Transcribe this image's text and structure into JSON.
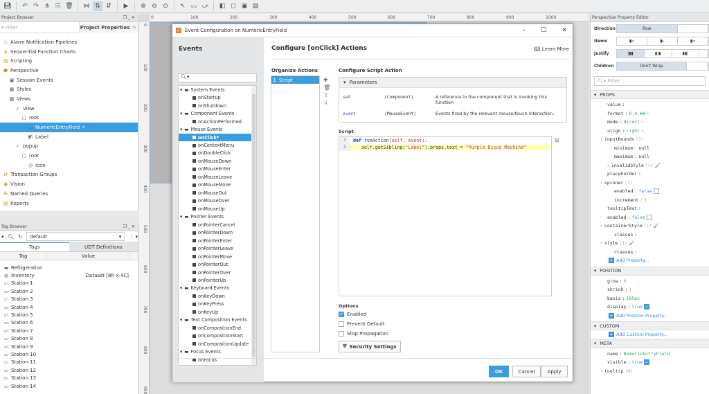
{
  "toolbar": {
    "icons": [
      "save-icon",
      "undo-icon",
      "redo-icon",
      "align-icon",
      "copy-icon",
      "delete-icon",
      "snap-icon",
      "flip-icon",
      "distribute-icon",
      "play-icon",
      "zoom-in-icon",
      "zoom-out-icon",
      "zoom-fit-icon",
      "pointer-icon",
      "bezier-icon",
      "path-icon",
      "group-icon",
      "ungroup-icon",
      "front-icon",
      "back-icon"
    ]
  },
  "project_browser": {
    "title": "Project Browser",
    "filter_placeholder": "Filter",
    "project_properties": "Project Properties",
    "items": [
      {
        "label": "Alarm Notification Pipelines",
        "indent": 0
      },
      {
        "label": "Sequential Function Charts",
        "indent": 0
      },
      {
        "label": "Scripting",
        "indent": 0
      },
      {
        "label": "Perspective",
        "indent": 0
      },
      {
        "label": "Session Events",
        "indent": 1
      },
      {
        "label": "Styles",
        "indent": 1
      },
      {
        "label": "Views",
        "indent": 1
      },
      {
        "label": "View",
        "indent": 2
      },
      {
        "label": "root",
        "indent": 3
      },
      {
        "label": "NumericEntryField",
        "indent": 4,
        "selected": true
      },
      {
        "label": "Label",
        "indent": 4
      },
      {
        "label": "popup",
        "indent": 2
      },
      {
        "label": "root",
        "indent": 3
      },
      {
        "label": "Icon",
        "indent": 4
      },
      {
        "label": "Transaction Groups",
        "indent": 0
      },
      {
        "label": "Vision",
        "indent": 0
      },
      {
        "label": "Named Queries",
        "indent": 0
      },
      {
        "label": "Reports",
        "indent": 0
      }
    ]
  },
  "tag_browser": {
    "title": "Tag Browser",
    "provider": "default",
    "tabs": [
      "Tags",
      "UDT Definitions"
    ],
    "columns": [
      "Tag",
      "Value"
    ],
    "rows": [
      {
        "tag": "Refrigeration",
        "value": ""
      },
      {
        "tag": "Inventory",
        "value": "Dataset [8R x 4C]"
      },
      {
        "tag": "Station 1",
        "value": ""
      },
      {
        "tag": "Station 2",
        "value": ""
      },
      {
        "tag": "Station 3",
        "value": ""
      },
      {
        "tag": "Station 4",
        "value": ""
      },
      {
        "tag": "Station 5",
        "value": ""
      },
      {
        "tag": "Station 6",
        "value": ""
      },
      {
        "tag": "Station 7",
        "value": ""
      },
      {
        "tag": "Station 8",
        "value": ""
      },
      {
        "tag": "Station 9",
        "value": ""
      },
      {
        "tag": "Station 10",
        "value": ""
      },
      {
        "tag": "Station 11",
        "value": ""
      },
      {
        "tag": "Station 12",
        "value": ""
      },
      {
        "tag": "Station 13",
        "value": ""
      },
      {
        "tag": "Station 14",
        "value": ""
      }
    ]
  },
  "rulers": {
    "h": [
      "0",
      "100",
      "200",
      "300",
      "400",
      "500",
      "600",
      "700",
      "800",
      "900",
      "1000"
    ],
    "v": [
      "0",
      "100",
      "200",
      "300",
      "400",
      "500",
      "600",
      "700",
      "800",
      "900"
    ]
  },
  "dialog": {
    "title": "Event Configuration on NumericEntryField",
    "events_heading": "Events",
    "configure_title": "Configure [onClick] Actions",
    "learn_more": "Learn More",
    "organize_actions": "Organize Actions",
    "actions": [
      "1. Script"
    ],
    "configure_script_action": "Configure Script Action",
    "parameters_label": "Parameters",
    "parameters": [
      {
        "name": "self",
        "type": "(Component)",
        "desc": "A reference to the component that is invoking this function"
      },
      {
        "name": "event",
        "type": "(MouseEvent)",
        "desc": "Events fired by the relevant mouse/touch interaction."
      }
    ],
    "script_label": "Script",
    "script_lines": [
      {
        "num": "1",
        "kw": "def",
        "fn": " runAction",
        "args": "(self, event):"
      },
      {
        "num": "2",
        "pre": "    self.getSibling(",
        "s1": "\"Label\"",
        "mid": ").props.text = ",
        "s2": "\"Purple Disco Machine\""
      }
    ],
    "options_label": "Options",
    "options": [
      {
        "label": "Enabled",
        "checked": true
      },
      {
        "label": "Prevent Default",
        "checked": false
      },
      {
        "label": "Stop Propagation",
        "checked": false
      }
    ],
    "security_settings": "Security Settings",
    "ok": "OK",
    "cancel": "Cancel",
    "apply": "Apply",
    "events": [
      {
        "label": "System Events",
        "group": true
      },
      {
        "label": "onStartup"
      },
      {
        "label": "onShutdown"
      },
      {
        "label": "Component Events",
        "group": true
      },
      {
        "label": "onActionPerformed"
      },
      {
        "label": "Mouse Events",
        "group": true
      },
      {
        "label": "onClick*",
        "selected": true
      },
      {
        "label": "onContextMenu"
      },
      {
        "label": "onDoubleClick"
      },
      {
        "label": "onMouseDown"
      },
      {
        "label": "onMouseEnter"
      },
      {
        "label": "onMouseLeave"
      },
      {
        "label": "onMouseMove"
      },
      {
        "label": "onMouseOut"
      },
      {
        "label": "onMouseOver"
      },
      {
        "label": "onMouseUp"
      },
      {
        "label": "Pointer Events",
        "group": true
      },
      {
        "label": "onPointerCancel"
      },
      {
        "label": "onPointerDown"
      },
      {
        "label": "onPointerEnter"
      },
      {
        "label": "onPointerLeave"
      },
      {
        "label": "onPointerMove"
      },
      {
        "label": "onPointerOut"
      },
      {
        "label": "onPointerOver"
      },
      {
        "label": "onPointerUp"
      },
      {
        "label": "Keyboard Events",
        "group": true
      },
      {
        "label": "onKeyDown"
      },
      {
        "label": "onKeyPress"
      },
      {
        "label": "onKeyUp"
      },
      {
        "label": "Text Composition Events",
        "group": true
      },
      {
        "label": "onCompositionEnd"
      },
      {
        "label": "onCompositionStart"
      },
      {
        "label": "onCompositionUpdate"
      },
      {
        "label": "Focus Events",
        "group": true
      },
      {
        "label": "onFocus"
      }
    ]
  },
  "property_editor": {
    "title": "Perspective Property Editor",
    "direction_label": "Direction",
    "direction_value": "Row",
    "items_label": "Items",
    "justify_label": "Justify",
    "children_label": "Children",
    "children_value": "Don't Wrap",
    "filter_placeholder": "Filter",
    "props_section": "PROPS",
    "position_section": "POSITION",
    "custom_section": "CUSTOM",
    "meta_section": "META",
    "props": [
      {
        "k": "value",
        "v": "",
        "i": 1
      },
      {
        "k": "format",
        "v": "0,0.##",
        "c": "g",
        "i": 1,
        "dd": true
      },
      {
        "k": "mode",
        "v": "direct",
        "c": "g",
        "i": 1,
        "dd": true
      },
      {
        "k": "align",
        "v": "right",
        "c": "g",
        "i": 1,
        "dd": true
      },
      {
        "k": "inputBounds",
        "n": "(3)",
        "i": 0,
        "tw": "▾"
      },
      {
        "k": "minimum",
        "v": "null",
        "i": 2
      },
      {
        "k": "maximum",
        "v": "null",
        "i": 2
      },
      {
        "k": "invalidStyle",
        "n": "(1)",
        "i": 1,
        "tw": "▸"
      },
      {
        "k": "placeholder",
        "v": "",
        "i": 1
      },
      {
        "k": "spinner",
        "n": "(2)",
        "i": 0,
        "tw": "▾"
      },
      {
        "k": "enabled",
        "v": "false",
        "c": "b",
        "i": 2,
        "cb": false
      },
      {
        "k": "increment",
        "v": "1",
        "c": "o",
        "i": 2
      },
      {
        "k": "tooltipText",
        "v": "",
        "i": 1
      },
      {
        "k": "enabled",
        "v": "false",
        "c": "b",
        "i": 1,
        "cb": false
      },
      {
        "k": "containerStyle",
        "n": "(1)",
        "i": 0,
        "tw": "▾"
      },
      {
        "k": "classes",
        "v": "",
        "i": 2
      },
      {
        "k": "style",
        "n": "(1)",
        "i": 0,
        "tw": "▾"
      },
      {
        "k": "classes",
        "v": "",
        "i": 2
      }
    ],
    "add_property": "Add Property...",
    "position": [
      {
        "k": "grow",
        "v": "0",
        "c": "o"
      },
      {
        "k": "shrink",
        "v": "1",
        "c": "o"
      },
      {
        "k": "basis",
        "v": "195px",
        "c": "g"
      },
      {
        "k": "display",
        "v": "true",
        "c": "b",
        "cb": true
      }
    ],
    "add_position_property": "Add Position Property...",
    "add_custom_property": "Add Custom Property...",
    "meta": [
      {
        "k": "name",
        "v": "NumericEntryField",
        "c": "g"
      },
      {
        "k": "visible",
        "v": "true",
        "c": "b",
        "cb": true
      },
      {
        "k": "tooltip",
        "n": "(8)",
        "tw": "▾"
      }
    ]
  }
}
